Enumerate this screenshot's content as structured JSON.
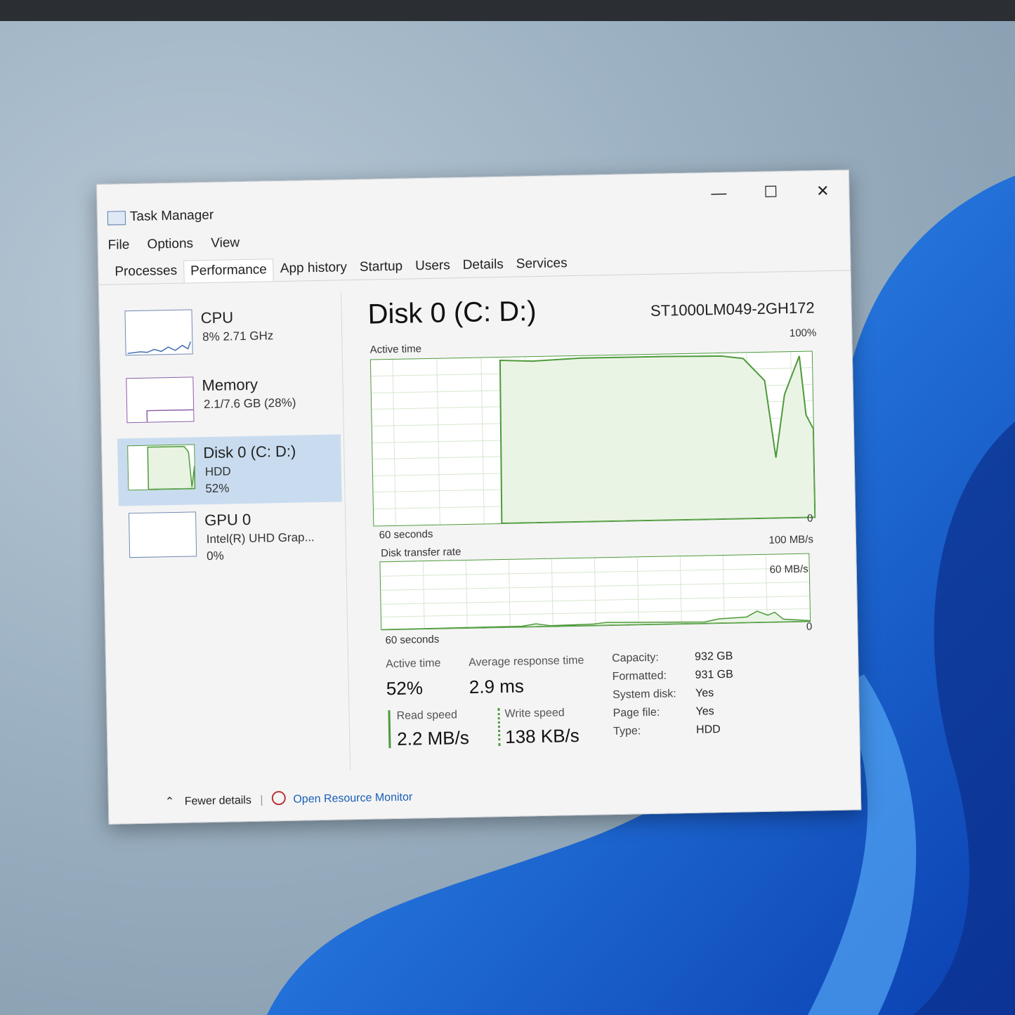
{
  "window": {
    "title": "Task Manager",
    "controls": {
      "minimize": "—",
      "maximize": "☐",
      "close": "✕"
    }
  },
  "menu": [
    "File",
    "Options",
    "View"
  ],
  "tabs": [
    "Processes",
    "Performance",
    "App history",
    "Startup",
    "Users",
    "Details",
    "Services"
  ],
  "active_tab": "Performance",
  "sidebar": [
    {
      "name": "CPU",
      "line2": "8% 2.71 GHz",
      "line3": ""
    },
    {
      "name": "Memory",
      "line2": "2.1/7.6 GB (28%)",
      "line3": ""
    },
    {
      "name": "Disk 0 (C: D:)",
      "line2": "HDD",
      "line3": "52%"
    },
    {
      "name": "GPU 0",
      "line2": "Intel(R) UHD Grap...",
      "line3": "0%"
    }
  ],
  "main": {
    "title": "Disk 0 (C: D:)",
    "model": "ST1000LM049-2GH172",
    "active_graph": {
      "label": "Active time",
      "max": "100%",
      "time": "60 seconds",
      "min": "0"
    },
    "transfer_graph": {
      "label": "Disk transfer rate",
      "max": "100 MB/s",
      "mid": "60 MB/s",
      "time": "60 seconds",
      "min": "0"
    },
    "stats": {
      "active_time_label": "Active time",
      "active_time": "52%",
      "avg_resp_label": "Average response time",
      "avg_resp": "2.9 ms",
      "read_label": "Read speed",
      "read": "2.2 MB/s",
      "write_label": "Write speed",
      "write": "138 KB/s"
    },
    "info": [
      {
        "label": "Capacity:",
        "value": "932 GB"
      },
      {
        "label": "Formatted:",
        "value": "931 GB"
      },
      {
        "label": "System disk:",
        "value": "Yes"
      },
      {
        "label": "Page file:",
        "value": "Yes"
      },
      {
        "label": "Type:",
        "value": "HDD"
      }
    ]
  },
  "footer": {
    "fewer": "Fewer details",
    "resource": "Open Resource Monitor"
  },
  "colors": {
    "disk_green": "#4d9a3b",
    "selection": "#c9dcef",
    "link": "#1a5fb4"
  }
}
